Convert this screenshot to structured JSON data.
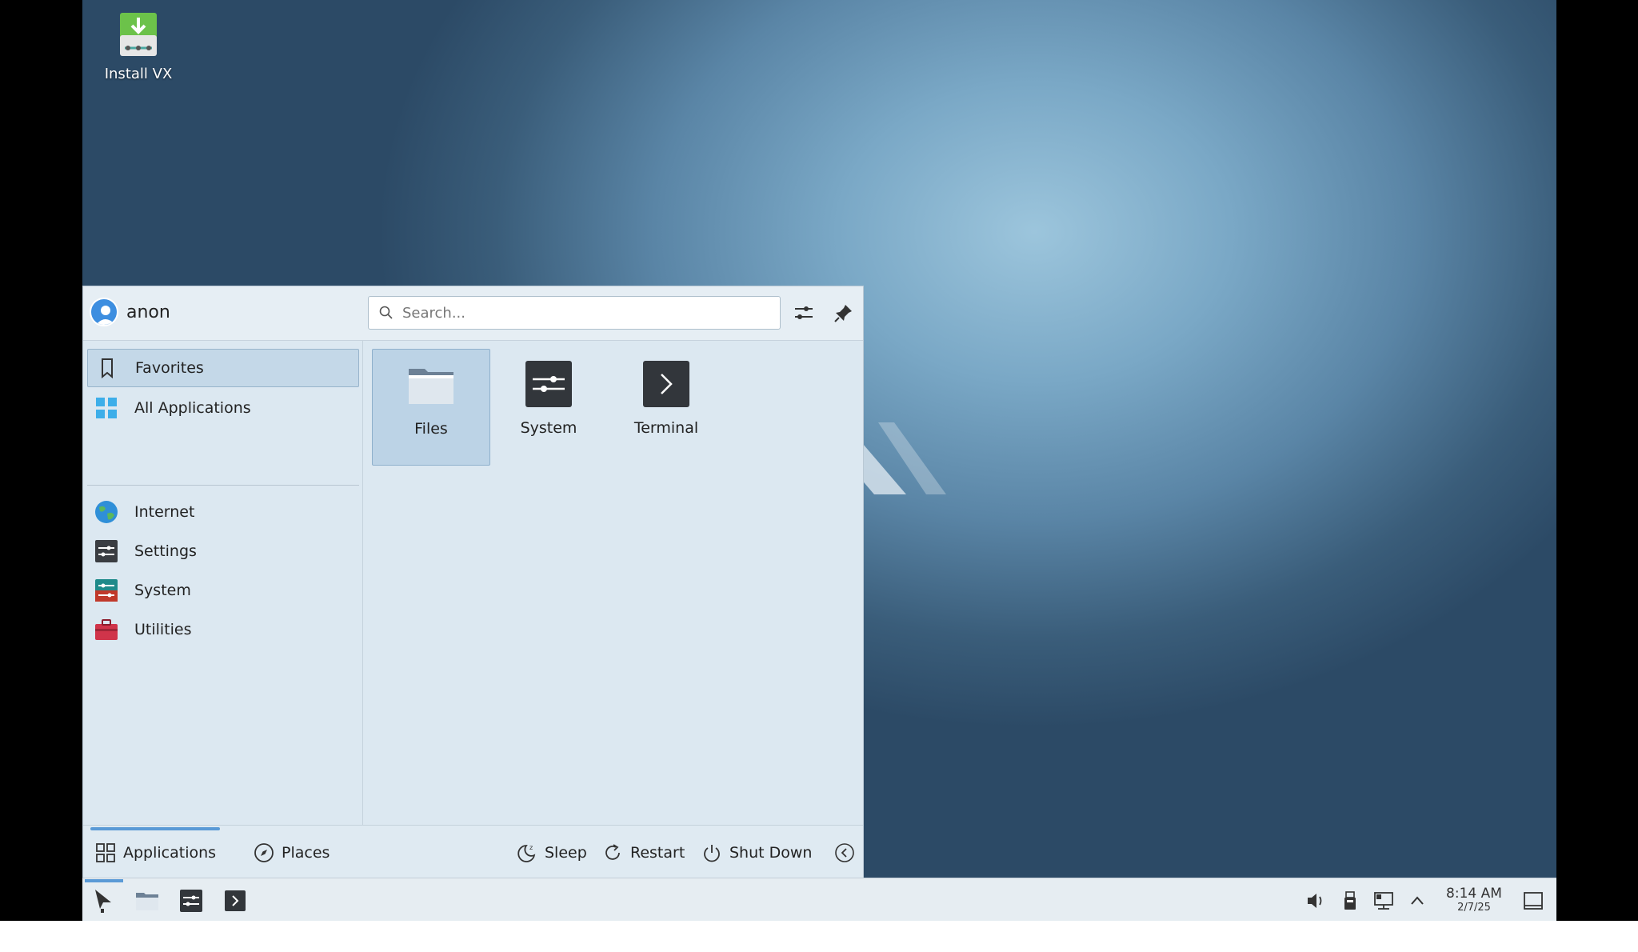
{
  "desktop": {
    "icons": [
      {
        "label": "Install VX",
        "icon": "install-download-icon"
      }
    ]
  },
  "menu": {
    "user": {
      "name": "anon",
      "icon": "user-avatar-icon"
    },
    "search": {
      "placeholder": "Search..."
    },
    "header_buttons": [
      {
        "name": "configure",
        "icon": "sliders-icon"
      },
      {
        "name": "pin",
        "icon": "pin-icon"
      }
    ],
    "categories": [
      {
        "label": "Favorites",
        "icon": "bookmark-icon",
        "active": true
      },
      {
        "label": "All Applications",
        "icon": "grid-apps-icon"
      },
      {
        "label": "Internet",
        "icon": "globe-icon"
      },
      {
        "label": "Settings",
        "icon": "settings-icon"
      },
      {
        "label": "System",
        "icon": "system-icon"
      },
      {
        "label": "Utilities",
        "icon": "toolbox-icon"
      }
    ],
    "apps": [
      {
        "label": "Files",
        "icon": "folder-icon",
        "selected": true
      },
      {
        "label": "System",
        "icon": "system-settings-icon"
      },
      {
        "label": "Terminal",
        "icon": "terminal-icon"
      }
    ],
    "footer": {
      "applications": "Applications",
      "places": "Places",
      "sleep": "Sleep",
      "restart": "Restart",
      "shutdown": "Shut Down"
    }
  },
  "taskbar": {
    "clock": {
      "time": "8:14 AM",
      "date": "2/7/25"
    },
    "launchers": [
      "application-menu-icon",
      "folder-icon",
      "system-settings-icon",
      "terminal-icon"
    ],
    "tray": [
      "volume-icon",
      "usb-drive-icon",
      "network-icon",
      "chevron-up-icon",
      "show-desktop-icon"
    ]
  },
  "colors": {
    "accent": "#5a9ad6",
    "menu_bg": "#dce8f1",
    "selection": "#c4d8e8"
  }
}
